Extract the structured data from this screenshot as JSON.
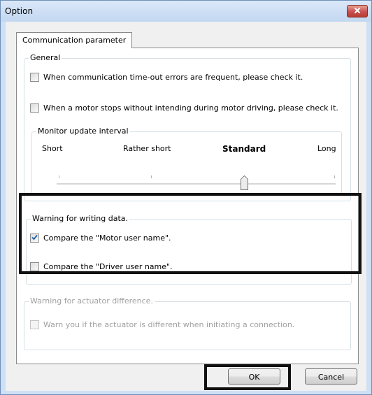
{
  "window": {
    "title": "Option"
  },
  "tabs": [
    {
      "label": "Communication parameter"
    }
  ],
  "general": {
    "label": "General",
    "checkboxes": [
      {
        "label": "When communication time-out errors are frequent, please check it.",
        "checked": false
      },
      {
        "label": "When a motor stops without intending during motor driving, please check it.",
        "checked": false
      }
    ]
  },
  "monitor": {
    "label": "Monitor update interval",
    "levels": [
      "Short",
      "Rather short",
      "Standard",
      "Long"
    ],
    "selected": "Standard"
  },
  "writing": {
    "label": "Warning for writing data.",
    "checkboxes": [
      {
        "label": "Compare the \"Motor user name\".",
        "checked": true
      },
      {
        "label": "Compare the \"Driver user name\".",
        "checked": false
      }
    ]
  },
  "actuator": {
    "label": "Warning for actuator difference.",
    "enabled": false,
    "checkboxes": [
      {
        "label": "Warn you if the actuator is different when initiating a connection.",
        "checked": false
      }
    ]
  },
  "buttons": {
    "ok": "OK",
    "cancel": "Cancel"
  },
  "colors": {
    "highlight": "#111111",
    "close_button": "#c75050",
    "check_mark": "#1d5fa8"
  }
}
